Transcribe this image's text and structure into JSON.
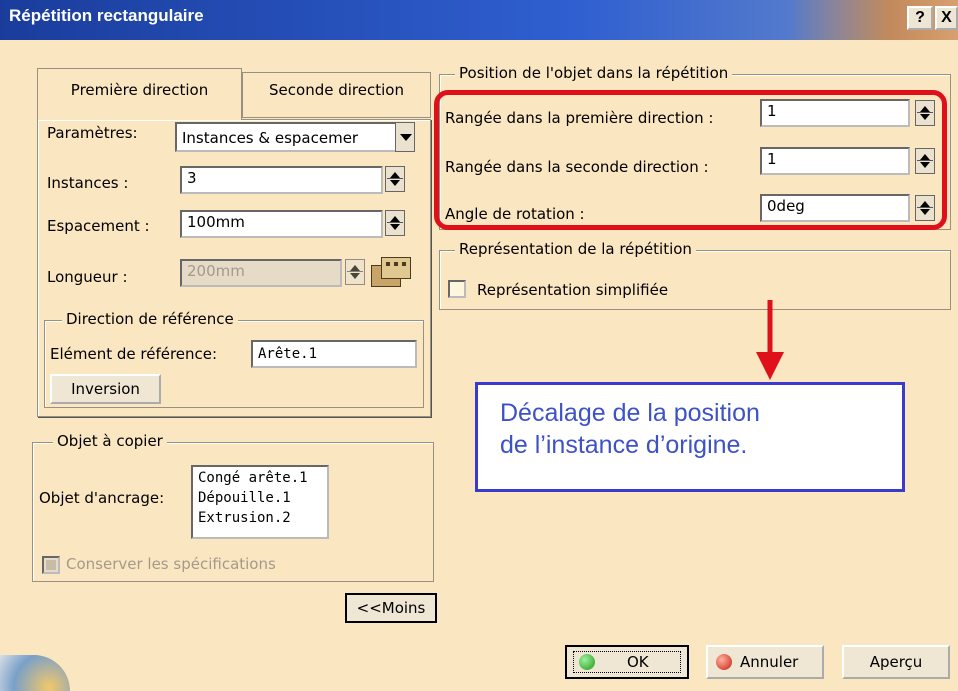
{
  "dialog": {
    "title": "Répétition rectangulaire",
    "help_btn": "?",
    "close_btn": "X"
  },
  "tabs": {
    "first": "Première direction",
    "second": "Seconde direction"
  },
  "params": {
    "parametres_label": "Paramètres:",
    "parametres_value": "Instances & espacemer",
    "instances_label": "Instances :",
    "instances_value": "3",
    "espacement_label": "Espacement :",
    "espacement_value": "100mm",
    "longueur_label": "Longueur :",
    "longueur_value": "200mm"
  },
  "reference": {
    "group_title": "Direction de référence",
    "element_label": "Elément de référence:",
    "element_value": "Arête.1",
    "inversion_btn": "Inversion"
  },
  "object": {
    "group_title": "Objet à copier",
    "anchor_label": "Objet d'ancrage:",
    "items": [
      "Congé arête.1",
      "Dépouille.1",
      "Extrusion.2"
    ],
    "keep_spec_label": "Conserver les spécifications"
  },
  "less_btn": "<<Moins",
  "position": {
    "group_title": "Position de l'objet dans la répétition",
    "row1_label": "Rangée dans la première direction :",
    "row1_value": "1",
    "row2_label": "Rangée dans la seconde direction :",
    "row2_value": "1",
    "angle_label": "Angle de rotation :",
    "angle_value": "0deg"
  },
  "representation": {
    "group_title": "Représentation de la répétition",
    "simplified_label": "Représentation simplifiée"
  },
  "callout": {
    "line1": "Décalage de la position",
    "line2": "de l’instance d’origine."
  },
  "buttons": {
    "ok": "OK",
    "cancel": "Annuler",
    "preview": "Aperçu"
  },
  "colors": {
    "highlight": "#e0101a",
    "callout_border": "#3a3ad0",
    "callout_text": "#3d52c5",
    "dialog_bg": "#fbe6c2",
    "titlebar": "#1a3d9c"
  }
}
